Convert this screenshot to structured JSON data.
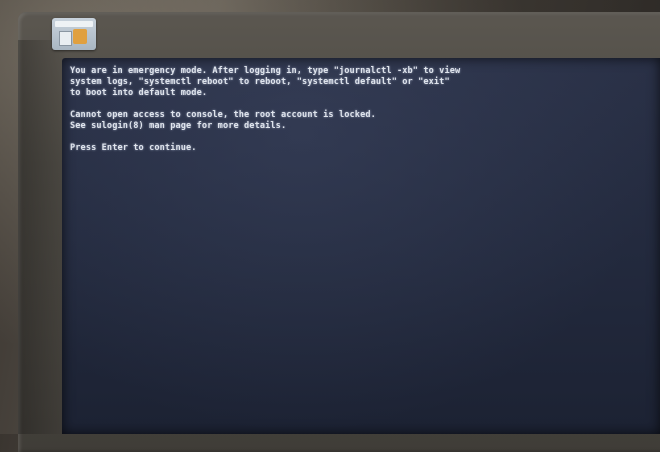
{
  "console": {
    "lines": [
      "You are in emergency mode. After logging in, type \"journalctl -xb\" to view",
      "system logs, \"systemctl reboot\" to reboot, \"systemctl default\" or \"exit\"",
      "to boot into default mode.",
      "",
      "Cannot open access to console, the root account is locked.",
      "See sulogin(8) man page for more details.",
      "",
      "Press Enter to continue."
    ]
  },
  "colors": {
    "screen_background": "#232a3e",
    "console_text": "#dfe4ec",
    "bezel": "#4b4842"
  }
}
